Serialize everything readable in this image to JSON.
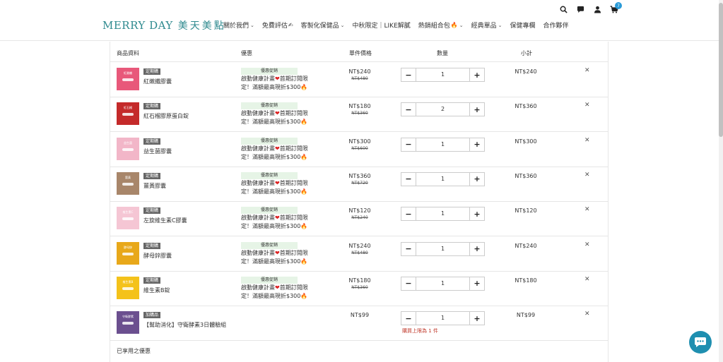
{
  "brand": {
    "logo_en": "MERRY DAY",
    "logo_zh": "美天美點",
    "color": "#2f8a8f"
  },
  "nav": [
    {
      "label": "關於我們",
      "chevron": true,
      "emoji": ""
    },
    {
      "label": "免費評估",
      "chevron": false,
      "emoji": "✍"
    },
    {
      "label": "客製化保健品",
      "chevron": true,
      "emoji": ""
    },
    {
      "label": "中秋限定｜LIKE解膩",
      "chevron": false,
      "emoji": ""
    },
    {
      "label": "熱銷組合包",
      "chevron": true,
      "emoji": "🔥"
    },
    {
      "label": "經典單品",
      "chevron": true,
      "emoji": ""
    },
    {
      "label": "保健專欄",
      "chevron": false,
      "emoji": ""
    },
    {
      "label": "合作夥伴",
      "chevron": false,
      "emoji": ""
    }
  ],
  "header_tools": {
    "search_icon": "search-icon",
    "chat_icon": "chat-icon",
    "account_icon": "user-icon",
    "cart_icon": "cart-icon",
    "cart_count": "7"
  },
  "table": {
    "headers": {
      "product": "商品資料",
      "promo": "優惠",
      "unit_price": "單件價格",
      "quantity": "數量",
      "subtotal": "小計"
    },
    "rows": [
      {
        "tag": "定期購",
        "name": "紅嫩纖膠囊",
        "promo_badge": "優惠促銷",
        "promo_text_a": "啟動健康計畫",
        "promo_text_b": "首期訂閱限定！滿額最高現折$300",
        "price": "NT$240",
        "orig": "NT$480",
        "qty": "1",
        "subtotal": "NT$240",
        "thumb_bg": "#e8587a",
        "thumb_text": "紅嫩纖"
      },
      {
        "tag": "定期購",
        "name": "紅石榴膠原蛋白錠",
        "promo_badge": "優惠促銷",
        "promo_text_a": "啟動健康計畫",
        "promo_text_b": "首期訂閱限定！滿額最高現折$300",
        "price": "NT$180",
        "orig": "NT$360",
        "qty": "2",
        "subtotal": "NT$360",
        "thumb_bg": "#c42a2a",
        "thumb_text": "紅石榴"
      },
      {
        "tag": "定期購",
        "name": "益生菌膠囊",
        "promo_badge": "優惠促銷",
        "promo_text_a": "啟動健康計畫",
        "promo_text_b": "首期訂閱限定！滿額最高現折$300",
        "price": "NT$300",
        "orig": "NT$600",
        "qty": "1",
        "subtotal": "NT$300",
        "thumb_bg": "#f2b6c8",
        "thumb_text": "益生菌"
      },
      {
        "tag": "定期購",
        "name": "薑黃膠囊",
        "promo_badge": "優惠促銷",
        "promo_text_a": "啟動健康計畫",
        "promo_text_b": "首期訂閱限定！滿額最高現折$300",
        "price": "NT$360",
        "orig": "NT$720",
        "qty": "1",
        "subtotal": "NT$360",
        "thumb_bg": "#a8866a",
        "thumb_text": "薑黃"
      },
      {
        "tag": "定期購",
        "name": "左旋維生素C膠囊",
        "promo_badge": "優惠促銷",
        "promo_text_a": "啟動健康計畫",
        "promo_text_b": "首期訂閱限定！滿額最高現折$300",
        "price": "NT$120",
        "orig": "NT$240",
        "qty": "1",
        "subtotal": "NT$120",
        "thumb_bg": "#f5c6d4",
        "thumb_text": "維生素C"
      },
      {
        "tag": "定期購",
        "name": "酵母鋅膠囊",
        "promo_badge": "優惠促銷",
        "promo_text_a": "啟動健康計畫",
        "promo_text_b": "首期訂閱限定！滿額最高現折$300",
        "price": "NT$240",
        "orig": "NT$480",
        "qty": "1",
        "subtotal": "NT$240",
        "thumb_bg": "#e8a81a",
        "thumb_text": "酵母鋅"
      },
      {
        "tag": "定期購",
        "name": "維生素B錠",
        "promo_badge": "優惠促銷",
        "promo_text_a": "啟動健康計畫",
        "promo_text_b": "首期訂閱限定！滿額最高現折$300",
        "price": "NT$180",
        "orig": "NT$360",
        "qty": "1",
        "subtotal": "NT$180",
        "thumb_bg": "#f4c21a",
        "thumb_text": "維生素B"
      },
      {
        "tag": "加購品",
        "name": "【幫助消化】守衛酵素3日體驗組",
        "promo_badge": "",
        "promo_text_a": "",
        "promo_text_b": "",
        "price": "NT$99",
        "orig": "",
        "qty": "1",
        "subtotal": "NT$99",
        "limit": "購買上限為 1 件",
        "thumb_bg": "#6b4f8f",
        "thumb_text": "守衛酵素"
      }
    ]
  },
  "used_promos_title": "已享用之優惠",
  "chat_widget_icon": "chat-bubble-icon"
}
